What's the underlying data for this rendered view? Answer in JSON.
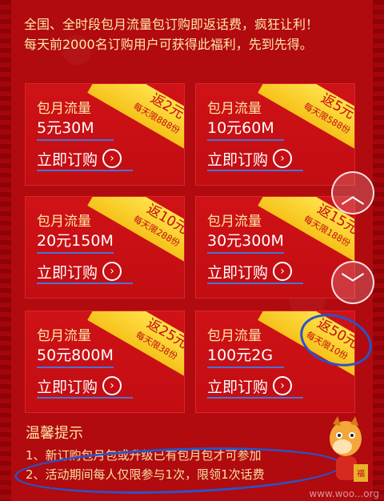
{
  "notice": {
    "line1": "全国、全时段包月流量包订购即返话费，疯狂让利！",
    "line2": "每天前2000名订购用户可获得此福利，先到先得。"
  },
  "cards": [
    {
      "tag": "包月流量",
      "price": "5元30M",
      "buy": "立即订购",
      "ribbon_top": "返2元",
      "ribbon_sub": "每天限888份"
    },
    {
      "tag": "包月流量",
      "price": "10元60M",
      "buy": "立即订购",
      "ribbon_top": "返5元",
      "ribbon_sub": "每天限588份"
    },
    {
      "tag": "包月流量",
      "price": "20元150M",
      "buy": "立即订购",
      "ribbon_top": "返10元",
      "ribbon_sub": "每天限288份"
    },
    {
      "tag": "包月流量",
      "price": "30元300M",
      "buy": "立即订购",
      "ribbon_top": "返15元",
      "ribbon_sub": "每天限188份"
    },
    {
      "tag": "包月流量",
      "price": "50元800M",
      "buy": "立即订购",
      "ribbon_top": "返25元",
      "ribbon_sub": "每天限38份"
    },
    {
      "tag": "包月流量",
      "price": "100元2G",
      "buy": "立即订购",
      "ribbon_top": "返50元",
      "ribbon_sub": "每天限10份"
    }
  ],
  "tips": {
    "title": "温馨提示",
    "items": [
      "1、新订购包月包或升级已有包月包才可参加",
      "2、活动期间每人仅限参与1次，限领1次话费"
    ]
  },
  "scroll": {
    "up": "︿",
    "down": "﹀"
  },
  "watermark": "www.woo...org",
  "colors": {
    "background": "#b10a0f",
    "ribbon": "#ffe14a",
    "accent_blue": "#2a53c8"
  }
}
